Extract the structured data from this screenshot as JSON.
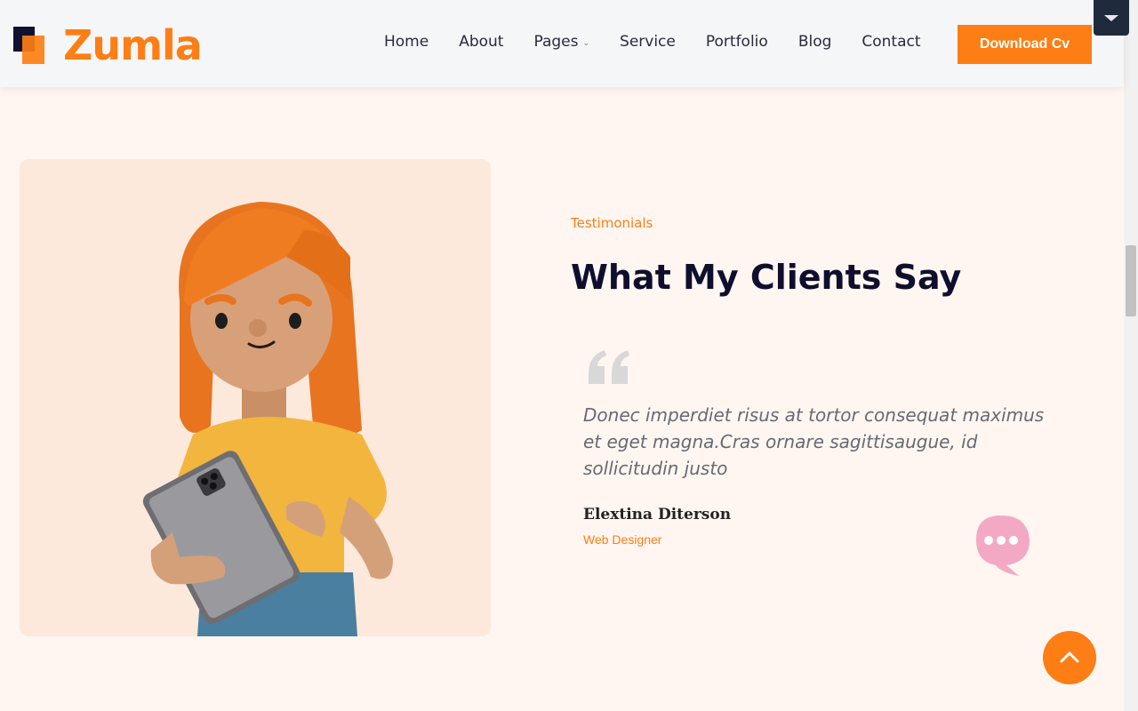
{
  "brand": {
    "name": "Zumla",
    "accent": "#fd7e14",
    "dark": "#0f0f2d"
  },
  "nav": {
    "items": [
      {
        "label": "Home"
      },
      {
        "label": "About"
      },
      {
        "label": "Pages",
        "has_dropdown": true
      },
      {
        "label": "Service"
      },
      {
        "label": "Portfolio"
      },
      {
        "label": "Blog"
      },
      {
        "label": "Contact"
      }
    ],
    "cta_label": "Download Cv"
  },
  "testimonials": {
    "tag": "Testimonials",
    "title": "What My Clients Say",
    "quote": "Donec imperdiet risus at tortor consequat maximus et eget magna.Cras ornare sagittisaugue, id sollicitudin justo",
    "author_name": "Elextina Diterson",
    "author_role": "Web Designer"
  },
  "icons": {
    "dropdown": "chevron-down-icon",
    "quote": "quote-icon",
    "chat": "chat-bubble-icon",
    "back_to_top": "arrow-up-icon"
  }
}
